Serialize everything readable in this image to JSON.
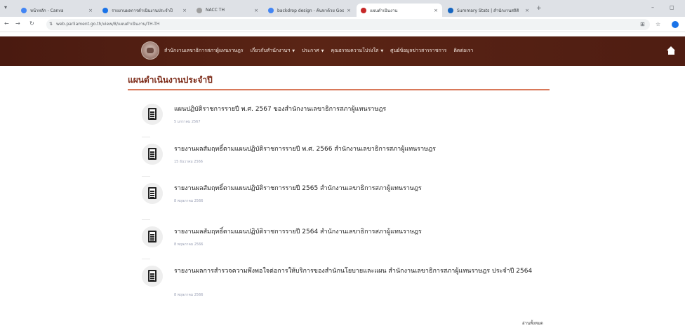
{
  "browser": {
    "tabs": [
      {
        "title": "หน้าหลัก - Canva",
        "color": "#4285f4",
        "active": false
      },
      {
        "title": "รายงานผลการดำเนินงานประจำปี",
        "color": "#1a73e8",
        "active": false
      },
      {
        "title": "NACC TH",
        "color": "#9e9e9e",
        "active": false
      },
      {
        "title": "backdrop design - ค้นหาด้วย Google",
        "color": "#4285f4",
        "active": false
      },
      {
        "title": "แผนดำเนินงาน",
        "color": "#c62828",
        "active": true
      },
      {
        "title": "Summary Stats | สำนักงานสถิติ",
        "color": "#1565c0",
        "active": false
      }
    ],
    "new_tab": "+",
    "url": "web.parliament.go.th/view/8/แผนดำเนินงาน/TH-TH"
  },
  "site": {
    "menu": [
      {
        "label": "สำนักงานเลขาธิการสภาผู้แทนราษฎร",
        "dropdown": false
      },
      {
        "label": "เกี่ยวกับสำนักงานฯ",
        "dropdown": true
      },
      {
        "label": "ประกาศ",
        "dropdown": true
      },
      {
        "label": "คุณธรรมความโปร่งใส",
        "dropdown": true
      },
      {
        "label": "ศูนย์ข้อมูลข่าวสารราชการ",
        "dropdown": false
      },
      {
        "label": "ติดต่อเรา",
        "dropdown": false
      }
    ],
    "caret": "▼"
  },
  "page": {
    "title": "แผนดำเนินงานประจำปี",
    "more": "อ่านทั้งหมด",
    "items": [
      {
        "title": "แผนปฏิบัติราชการรายปี พ.ศ. 2567 ของสำนักงานเลขาธิการสภาผู้แทนราษฎร",
        "date": "5 มกราคม 2567"
      },
      {
        "title": "รายงานผลสัมฤทธิ์ตามแผนปฏิบัติราชการรายปี พ.ศ. 2566 สำนักงานเลขาธิการสภาผู้แทนราษฎร",
        "date": "15 ธันวาคม 2566"
      },
      {
        "title": "รายงานผลสัมฤทธิ์ตามแผนปฏิบัติราชการรายปี 2565 สำนักงานเลขาธิการสภาผู้แทนราษฎร",
        "date": "8 พฤษภาคม 2566"
      },
      {
        "title": "รายงานผลสัมฤทธิ์ตามแผนปฏิบัติราชการรายปี 2564 สำนักงานเลขาธิการสภาผู้แทนราษฎร",
        "date": "8 พฤษภาคม 2566"
      },
      {
        "title": "รายงานผลการสำรวจความพึงพอใจต่อการให้บริการของสำนักนโยบายและแผน สำนักงานเลขาธิการสภาผู้แทนราษฎร ประจำปี 2564",
        "date": "8 พฤษภาคม 2566"
      }
    ]
  }
}
